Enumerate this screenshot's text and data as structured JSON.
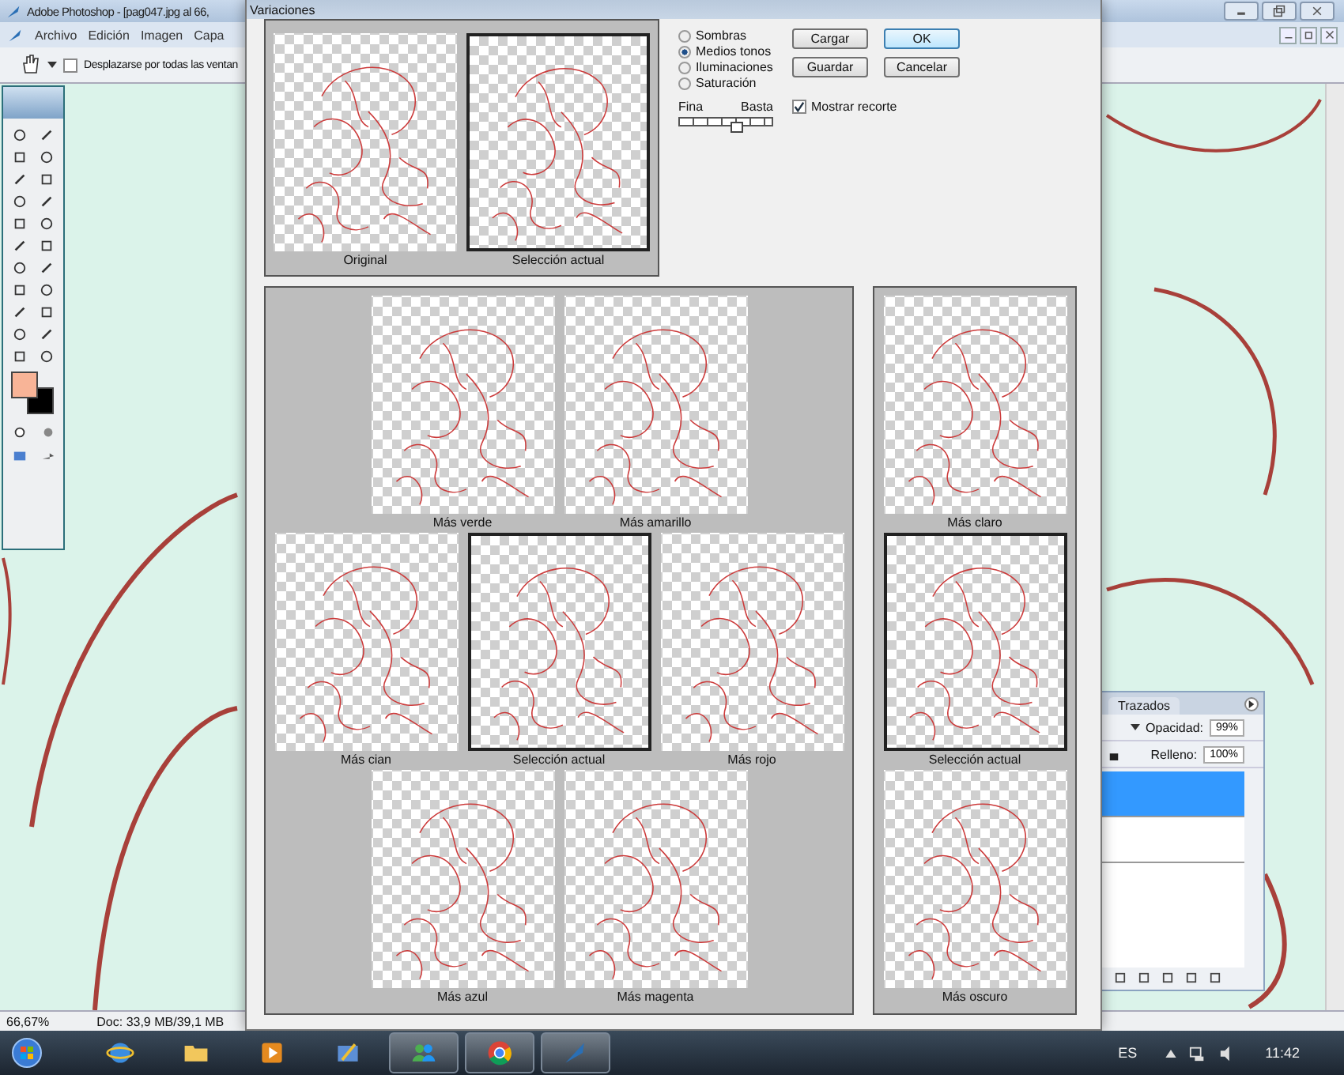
{
  "app": {
    "title": "Adobe Photoshop - [pag047.jpg al 66,",
    "menu": [
      "Archivo",
      "Edición",
      "Imagen",
      "Capa"
    ],
    "options_bar": {
      "label": "Desplazarse por todas las ventan",
      "checked": false
    },
    "status_bar": {
      "zoom": "66,67%",
      "doc": "Doc: 33,9 MB/39,1 MB"
    }
  },
  "dialog": {
    "title": "Variaciones",
    "top_previews": [
      {
        "label": "Original",
        "selected": false
      },
      {
        "label": "Selección actual",
        "selected": true
      }
    ],
    "tones": [
      {
        "label": "Sombras",
        "selected": false
      },
      {
        "label": "Medios tonos",
        "selected": true
      },
      {
        "label": "Iluminaciones",
        "selected": false
      },
      {
        "label": "Saturación",
        "selected": false
      }
    ],
    "slider": {
      "min_label": "Fina",
      "max_label": "Basta",
      "level": 0.6
    },
    "buttons": [
      {
        "label": "Cargar",
        "default": false
      },
      {
        "label": "OK",
        "default": true
      },
      {
        "label": "Guardar",
        "default": false
      },
      {
        "label": "Cancelar",
        "default": false
      }
    ],
    "show_clipping": {
      "label": "Mostrar recorte",
      "checked": true
    },
    "color_variations": [
      [
        {
          "label": "Más verde",
          "selected": false
        },
        {
          "label": "Más amarillo",
          "selected": false
        }
      ],
      [
        {
          "label": "Más cian",
          "selected": false
        },
        {
          "label": "Selección actual",
          "selected": true
        },
        {
          "label": "Más rojo",
          "selected": false
        }
      ],
      [
        {
          "label": "Más azul",
          "selected": false
        },
        {
          "label": "Más magenta",
          "selected": false
        }
      ]
    ],
    "brightness_variations": [
      {
        "label": "Más claro",
        "selected": false
      },
      {
        "label": "Selección actual",
        "selected": true
      },
      {
        "label": "Más oscuro",
        "selected": false
      }
    ]
  },
  "layers_panel": {
    "tab": "Trazados",
    "opacity_label": "Opacidad:",
    "opacity": "99%",
    "fill_label": "Relleno:",
    "fill": "100%",
    "layers": [
      {
        "selected": true
      },
      {
        "selected": false
      }
    ]
  },
  "taskbar": {
    "apps": [
      {
        "kind": "browser",
        "open": false
      },
      {
        "kind": "folder",
        "open": false
      },
      {
        "kind": "media",
        "open": false
      },
      {
        "kind": "paint",
        "open": false
      },
      {
        "kind": "messenger",
        "open": true
      },
      {
        "kind": "chrome",
        "open": true
      },
      {
        "kind": "feather",
        "open": true
      }
    ],
    "language": "ES",
    "clock": "11:42"
  }
}
